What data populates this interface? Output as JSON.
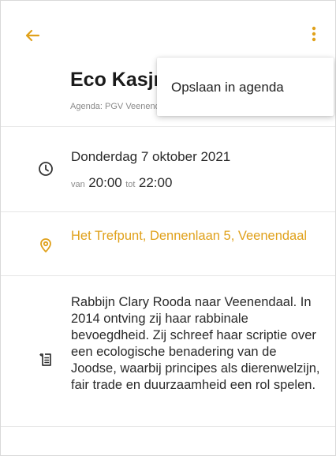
{
  "header": {
    "back_icon": "arrow-left-icon",
    "more_icon": "more-vertical-icon",
    "accent_color": "#E0A11B"
  },
  "event": {
    "title": "Eco Kasjrut",
    "agenda_label": "Agenda: PGV Veenendaal",
    "date": "Donderdag 7 oktober 2021",
    "time_from_label": "van",
    "start_time": "20:00",
    "time_to_label": "tot",
    "end_time": "22:00",
    "location": "Het Trefpunt, Dennenlaan 5, Veenendaal",
    "description": "Rabbijn Clary Rooda naar Veenendaal. In 2014 ontving zij haar rabbinale bevoegdheid. Zij schreef haar scriptie over een ecologische benadering van de Joodse, waarbij principes als dierenwelzijn, fair trade en duurzaamheid een rol spelen."
  },
  "menu": {
    "items": [
      {
        "label": "Opslaan in agenda"
      }
    ]
  },
  "icons": {
    "date": "clock-icon",
    "location": "location-pin-icon",
    "description": "notes-icon"
  }
}
